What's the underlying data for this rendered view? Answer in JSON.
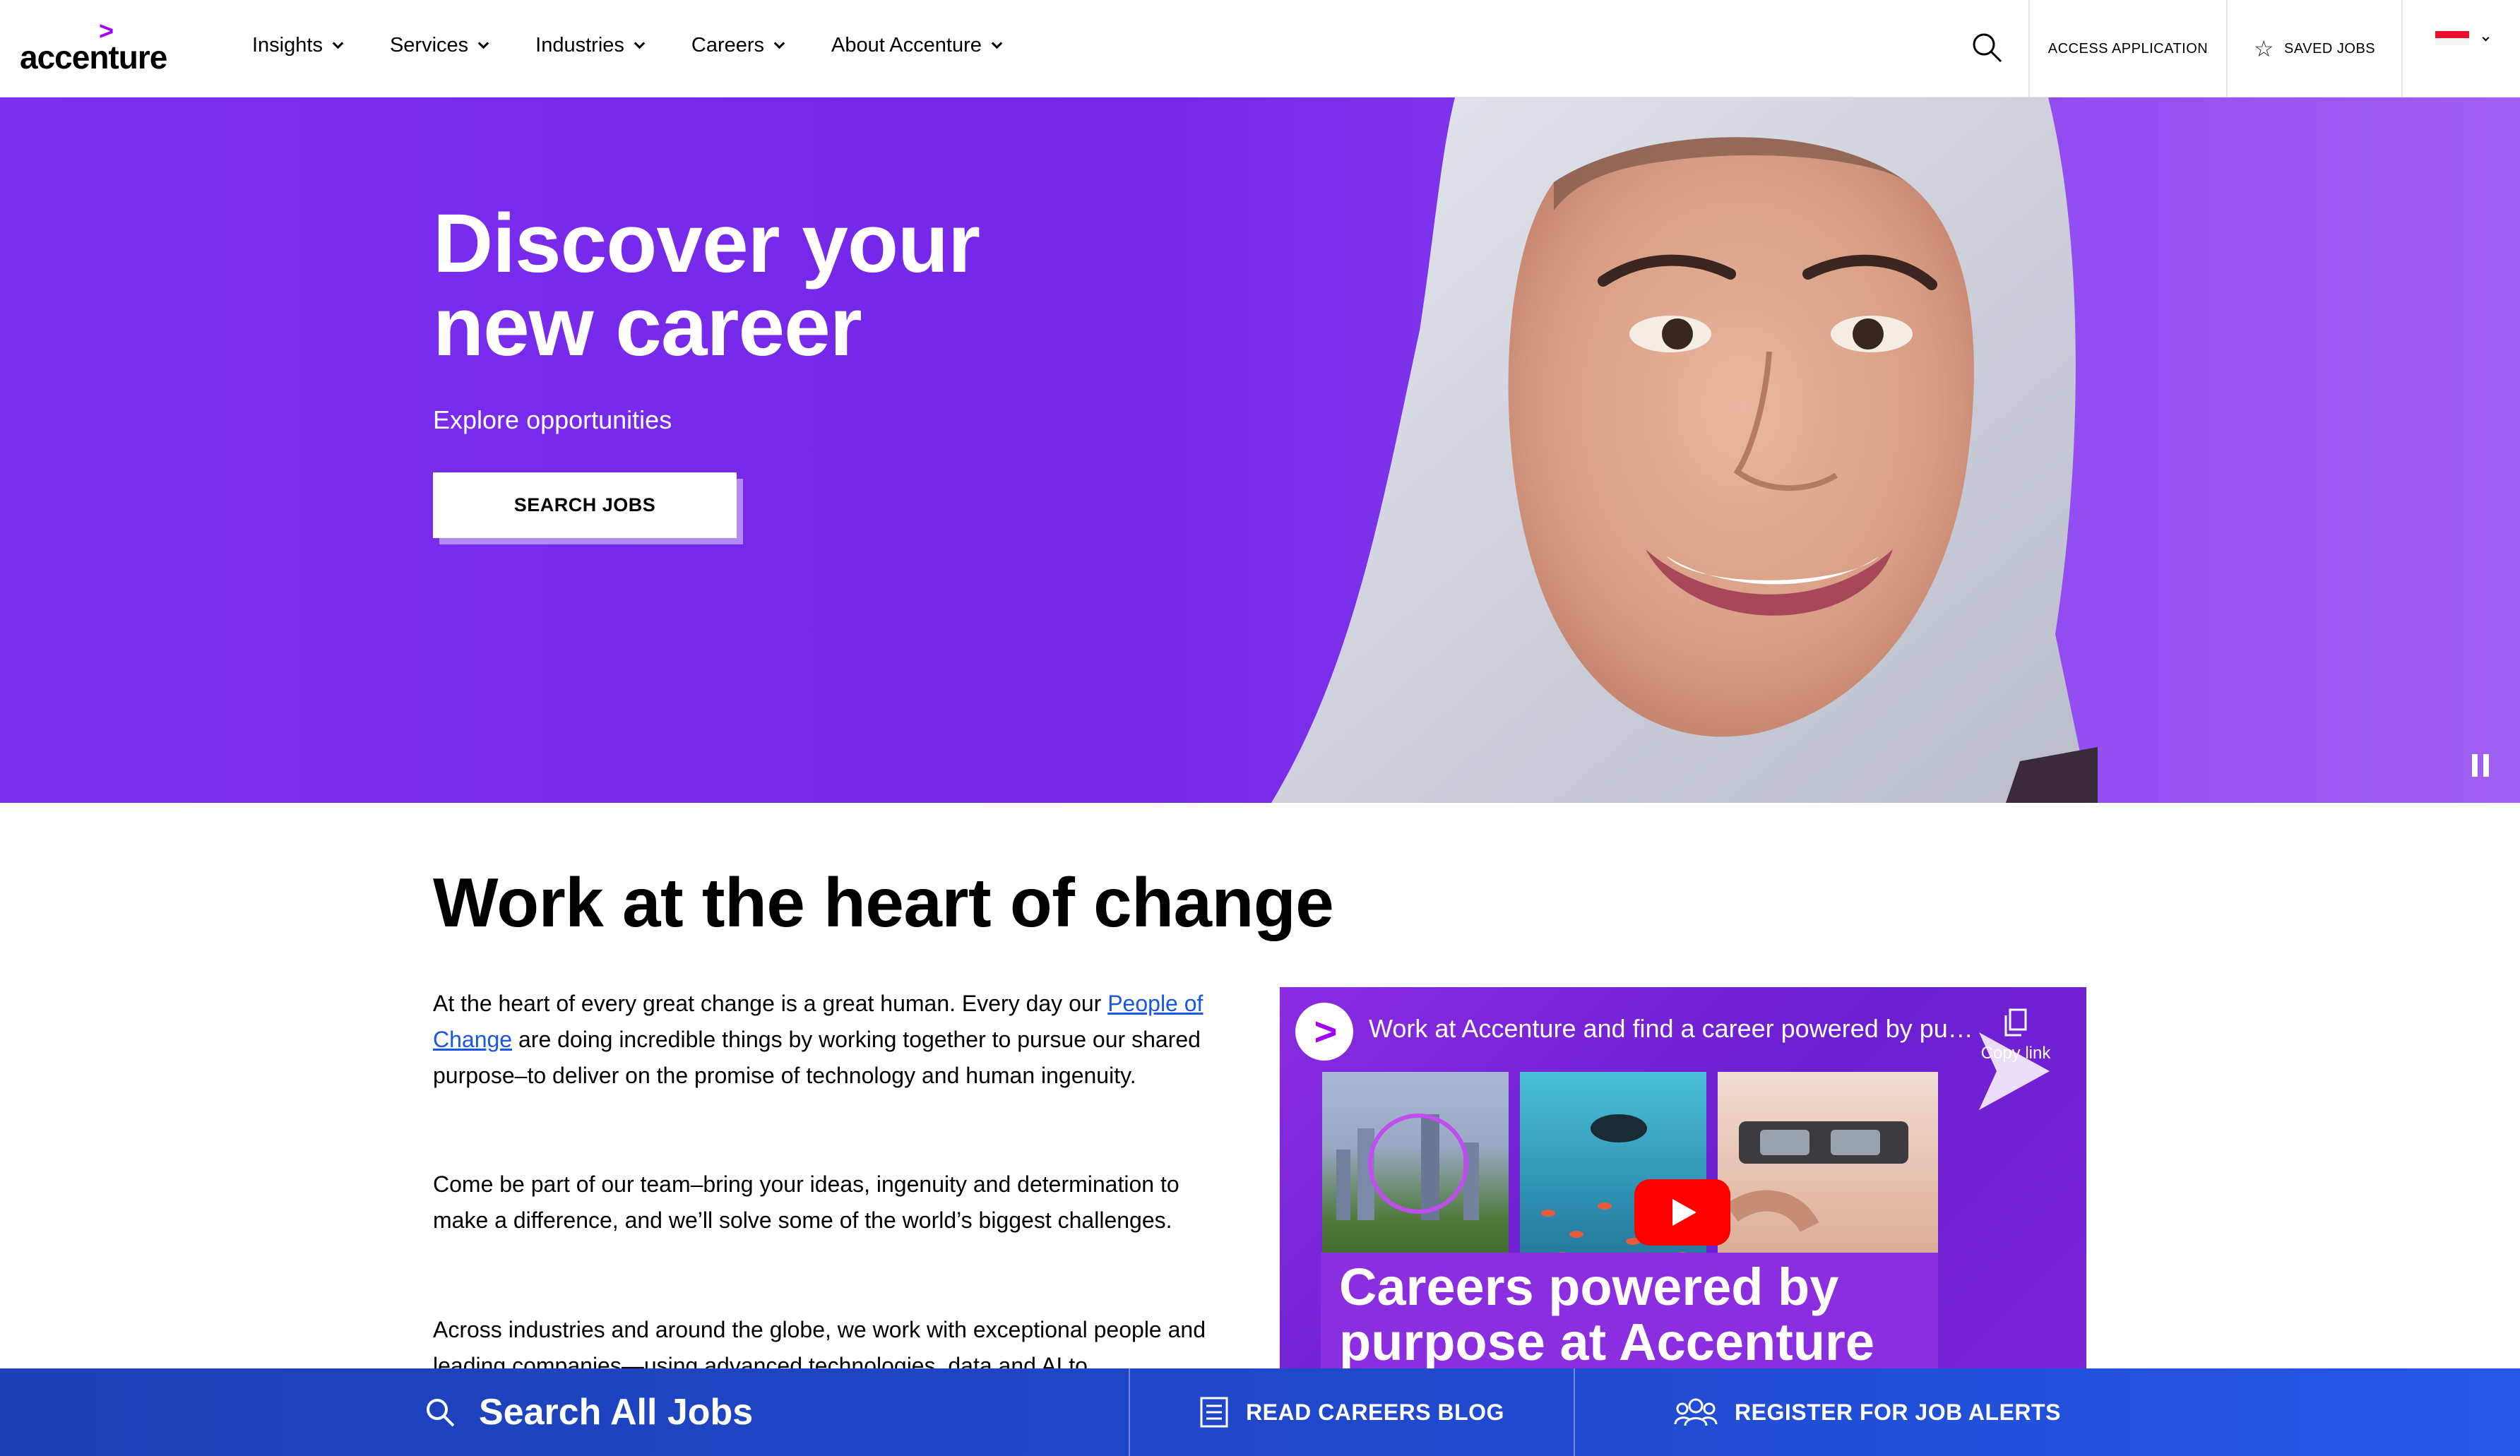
{
  "header": {
    "logo_text": "accenture",
    "logo_mark": ">",
    "nav": [
      {
        "label": "Insights"
      },
      {
        "label": "Services"
      },
      {
        "label": "Industries"
      },
      {
        "label": "Careers"
      },
      {
        "label": "About Accenture"
      }
    ],
    "access_application": "ACCESS APPLICATION",
    "saved_jobs": "SAVED JOBS",
    "icons": [
      "search-icon",
      "star-icon",
      "flag-icon",
      "chevron-down-icon"
    ]
  },
  "hero": {
    "title": "Discover your new career",
    "subtitle": "Explore opportunities",
    "cta": "SEARCH JOBS",
    "background_color": "#7b2ff0"
  },
  "content": {
    "heading": "Work at the heart of change",
    "p1_before": "At the heart of every great change is a great human. Every day our ",
    "p1_link": "People of Change",
    "p1_after": " are doing incredible things by working together to pursue our shared purpose–to deliver on the promise of technology and human ingenuity.",
    "p2": "Come be part of our team–bring your ideas, ingenuity and determination to make a difference, and we’ll solve some of the world’s biggest challenges.",
    "p3": "Across industries and around the globe, we work with exceptional people and leading companies—using advanced technologies, data and AI to"
  },
  "video": {
    "title": "Work at Accenture and find a career powered by pu…",
    "copy_link": "Copy link",
    "caption_line1": "Careers powered by",
    "caption_line2": "purpose at Accenture"
  },
  "bottom_bar": {
    "search_all": "Search All Jobs",
    "blog": "READ CAREERS BLOG",
    "alerts": "REGISTER FOR JOB ALERTS",
    "color": "#1f46c6"
  }
}
